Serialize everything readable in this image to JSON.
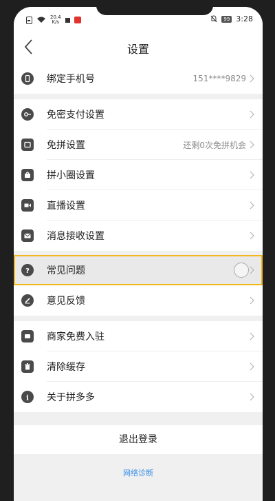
{
  "status": {
    "speed": "20.4\nK/s",
    "battery": "99",
    "time": "3:28"
  },
  "header": {
    "title": "设置"
  },
  "groups": [
    [
      {
        "label": "绑定手机号",
        "value": "151****9829",
        "icon": "phone-icon"
      }
    ],
    [
      {
        "label": "免密支付设置",
        "value": "",
        "icon": "key-icon"
      },
      {
        "label": "免拼设置",
        "value": "还剩0次免拼机会",
        "icon": "ticket-icon"
      },
      {
        "label": "拼小圈设置",
        "value": "",
        "icon": "bag-icon"
      },
      {
        "label": "直播设置",
        "value": "",
        "icon": "video-icon"
      },
      {
        "label": "消息接收设置",
        "value": "",
        "icon": "mail-icon"
      }
    ],
    [
      {
        "label": "常见问题",
        "value": "",
        "icon": "question-icon",
        "highlighted": true
      },
      {
        "label": "意见反馈",
        "value": "",
        "icon": "edit-icon"
      }
    ],
    [
      {
        "label": "商家免费入驻",
        "value": "",
        "icon": "store-icon"
      },
      {
        "label": "清除缓存",
        "value": "",
        "icon": "trash-icon"
      },
      {
        "label": "关于拼多多",
        "value": "",
        "icon": "info-icon"
      }
    ]
  ],
  "footer": {
    "logout": "退出登录",
    "diagnose": "网络诊断"
  },
  "colors": {
    "highlight_border": "#f2b71b",
    "link": "#3a8ee6"
  }
}
